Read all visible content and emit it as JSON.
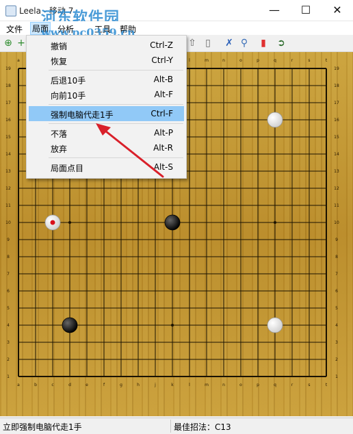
{
  "window": {
    "title": "Leela - 移动 7",
    "minimize_icon": "minimize-icon",
    "maximize_icon": "maximize-icon",
    "close_icon": "close-icon"
  },
  "watermark": {
    "line1": "河东软件园",
    "line2": "www.pc0359.cn"
  },
  "menubar": {
    "items": [
      "文件",
      "局面",
      "分析",
      "工具",
      "帮助"
    ],
    "active": "局面"
  },
  "toolbar": {
    "icons": [
      "new-game-icon",
      "add-icon",
      "up-icon",
      "eject-icon",
      "cross-icon",
      "magnifier-icon",
      "bookmark-icon",
      "export-icon"
    ]
  },
  "dropdown": {
    "items": [
      {
        "label": "撤销",
        "shortcut": "Ctrl-Z"
      },
      {
        "label": "恢复",
        "shortcut": "Ctrl-Y"
      },
      {
        "label": "后退10手",
        "shortcut": "Alt-B"
      },
      {
        "label": "向前10手",
        "shortcut": "Alt-F"
      },
      {
        "label": "强制电脑代走1手",
        "shortcut": "Ctrl-F",
        "highlighted": true
      },
      {
        "label": "不落",
        "shortcut": "Alt-P"
      },
      {
        "label": "放弃",
        "shortcut": "Alt-R"
      },
      {
        "label": "局面点目",
        "shortcut": "Alt-S"
      }
    ]
  },
  "board": {
    "size": 19,
    "col_labels": [
      "a",
      "b",
      "c",
      "d",
      "e",
      "f",
      "g",
      "h",
      "j",
      "k",
      "l",
      "m",
      "n",
      "o",
      "p",
      "q",
      "r",
      "s",
      "t"
    ],
    "row_labels": [
      "19",
      "18",
      "17",
      "16",
      "15",
      "14",
      "13",
      "12",
      "11",
      "10",
      "9",
      "8",
      "7",
      "6",
      "5",
      "4",
      "3",
      "2",
      "1"
    ],
    "star_points": [
      "d16",
      "k16",
      "q16",
      "d10",
      "k10",
      "q10",
      "d4",
      "k4",
      "q4"
    ],
    "stones": [
      {
        "color": "white",
        "point": "q16",
        "last_move": false
      },
      {
        "color": "white",
        "point": "c10",
        "last_move": true
      },
      {
        "color": "black",
        "point": "k10",
        "last_move": false
      },
      {
        "color": "black",
        "point": "d4",
        "last_move": false
      },
      {
        "color": "white",
        "point": "q4",
        "last_move": false
      }
    ],
    "arrow_color": "#d9202a"
  },
  "statusbar": {
    "left": "立即强制电脑代走1手",
    "right": "最佳招法：C13"
  }
}
